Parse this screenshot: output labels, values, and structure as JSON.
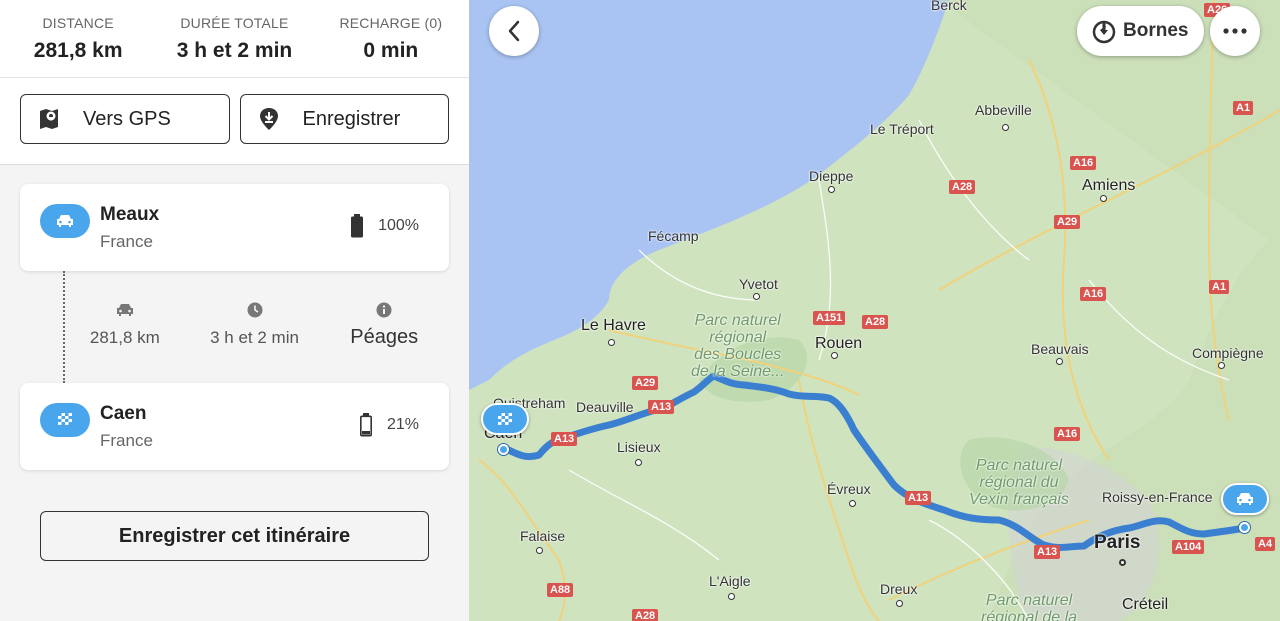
{
  "summary": {
    "distance_label": "DISTANCE",
    "distance_value": "281,8 km",
    "duration_label": "DURÉE TOTALE",
    "duration_value": "3 h et 2 min",
    "recharge_label": "RECHARGE (0)",
    "recharge_value": "0 min"
  },
  "actions": {
    "gps_label": "Vers GPS",
    "save_label": "Enregistrer"
  },
  "origin": {
    "city": "Meaux",
    "country": "France",
    "battery": "100%",
    "battery_level": 1.0
  },
  "leg": {
    "distance": "281,8 km",
    "duration": "3 h et 2 min",
    "tolls": "Péages"
  },
  "destination": {
    "city": "Caen",
    "country": "France",
    "battery": "21%",
    "battery_level": 0.21
  },
  "save_route_label": "Enregistrer cet itinéraire",
  "map": {
    "bornes_label": "Bornes",
    "places": [
      "Berck",
      "Abbeville",
      "Le Tréport",
      "Dieppe",
      "Amiens",
      "Fécamp",
      "Yvetot",
      "Le Havre",
      "Rouen",
      "Beauvais",
      "Compiègne",
      "Ouistreham",
      "Caen",
      "Deauville",
      "Lisieux",
      "Évreux",
      "Roissy-en-France",
      "Paris",
      "Falaise",
      "L'Aigle",
      "Dreux",
      "Créteil"
    ],
    "parks": [
      "Parc naturel régional des Boucles de la Seine...",
      "Parc naturel régional du Vexin français",
      "Parc naturel régional de la"
    ],
    "roads": [
      "A26",
      "A1",
      "A16",
      "A28",
      "A29",
      "A151",
      "A28",
      "A16",
      "A1",
      "A29",
      "A13",
      "A13",
      "A16",
      "A13",
      "A13",
      "A104",
      "A4",
      "A88",
      "A28"
    ]
  },
  "colors": {
    "accent": "#4aa6ec",
    "route": "#3b7fd1",
    "road_badge": "#d9534f",
    "sea": "#a9c4f2",
    "land": "#cfe3bf"
  }
}
